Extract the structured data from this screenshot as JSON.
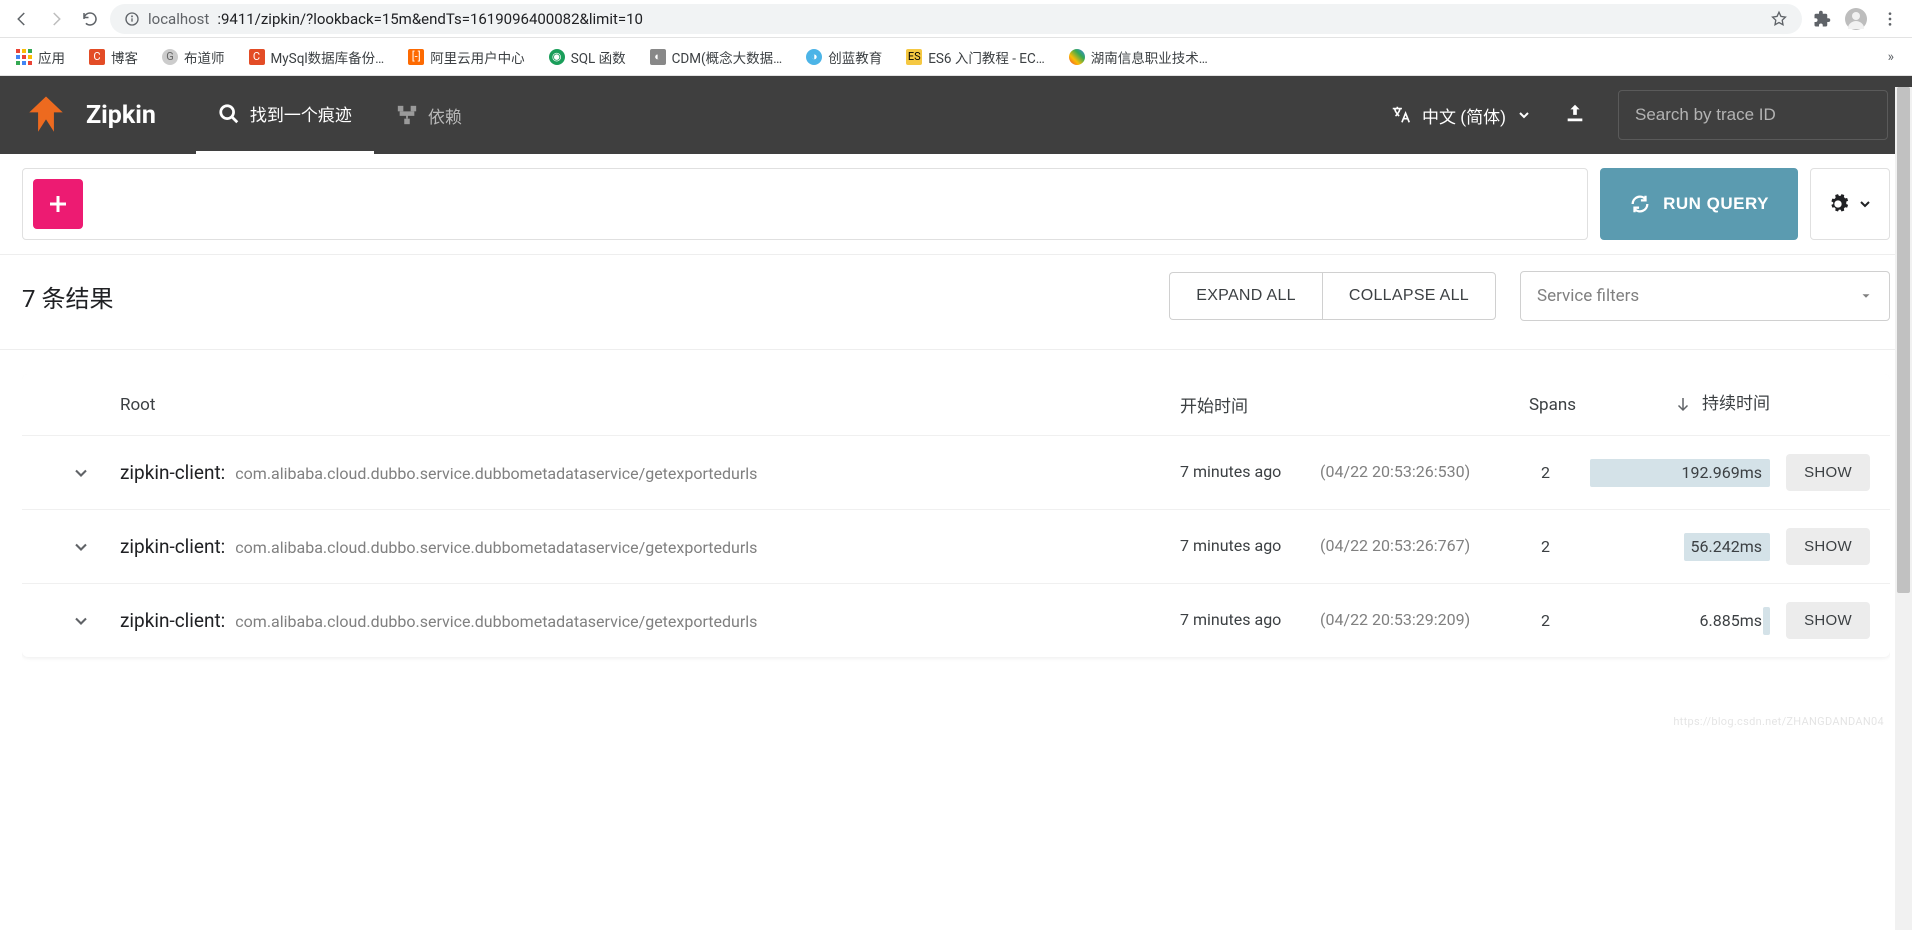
{
  "browser": {
    "url_host": "localhost",
    "url_port_path": ":9411/zipkin/?lookback=15m&endTs=1619096400082&limit=10"
  },
  "bookmarks": {
    "apps": "应用",
    "items": [
      "博客",
      "布道师",
      "MySql数据库备份…",
      "阿里云用户中心",
      "SQL 函数",
      "CDM(概念大数据…",
      "创蓝教育",
      "ES6 入门教程 - EC…",
      "湖南信息职业技术…"
    ],
    "overflow": "»"
  },
  "header": {
    "brand": "Zipkin",
    "tab_search": "找到一个痕迹",
    "tab_deps": "依赖",
    "language": "中文 (简体)",
    "search_placeholder": "Search by trace ID"
  },
  "query": {
    "run_label": "RUN QUERY"
  },
  "results": {
    "count_label": "7 条结果",
    "expand": "EXPAND ALL",
    "collapse": "COLLAPSE ALL",
    "service_filters": "Service filters"
  },
  "columns": {
    "root": "Root",
    "start": "开始时间",
    "spans": "Spans",
    "duration": "持续时间"
  },
  "rows": [
    {
      "service": "zipkin-client:",
      "span": "com.alibaba.cloud.dubbo.service.dubbometadataservice/getexportedurls",
      "rel": "7 minutes ago",
      "abs": "(04/22 20:53:26:530)",
      "spans": "2",
      "dur_label": "192.969ms",
      "bar_pct": 100,
      "show": "SHOW"
    },
    {
      "service": "zipkin-client:",
      "span": "com.alibaba.cloud.dubbo.service.dubbometadataservice/getexportedurls",
      "rel": "7 minutes ago",
      "abs": "(04/22 20:53:26:767)",
      "spans": "2",
      "dur_label": "56.242ms",
      "bar_pct": 48,
      "show": "SHOW"
    },
    {
      "service": "zipkin-client:",
      "span": "com.alibaba.cloud.dubbo.service.dubbometadataservice/getexportedurls",
      "rel": "7 minutes ago",
      "abs": "(04/22 20:53:29:209)",
      "spans": "2",
      "dur_label": "6.885ms",
      "bar_pct": 4,
      "show": "SHOW"
    }
  ]
}
